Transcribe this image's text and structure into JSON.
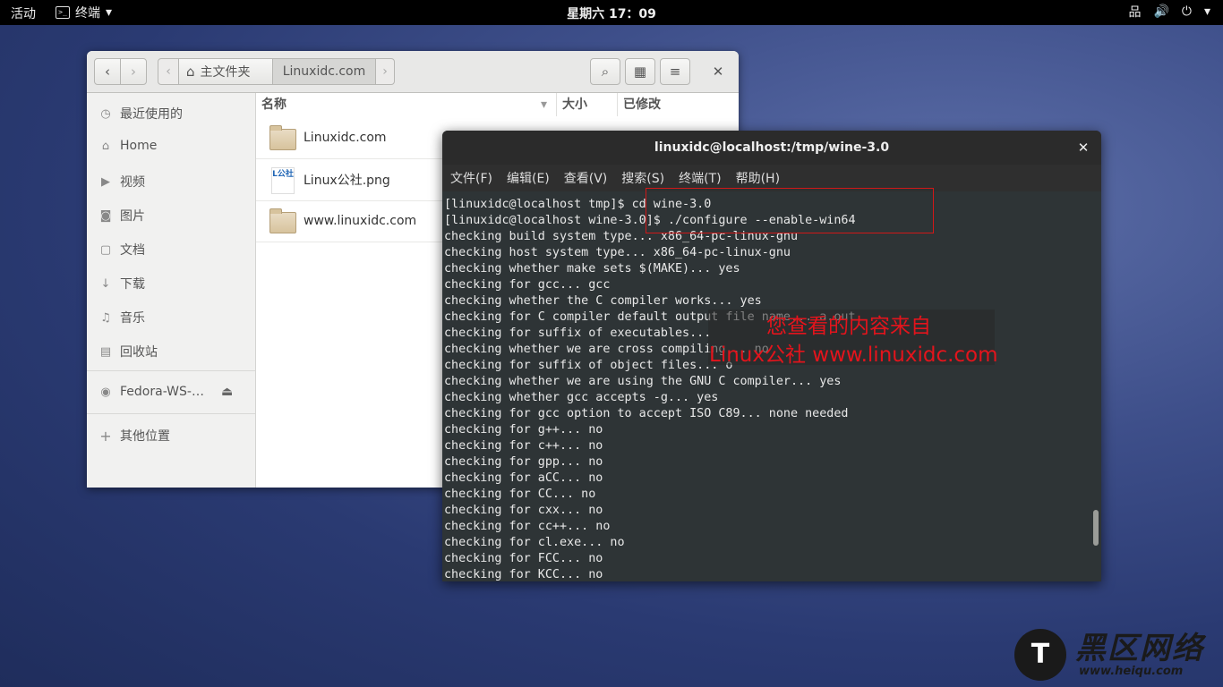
{
  "topbar": {
    "activities": "活动",
    "app_name": "终端",
    "app_arrow": "▾",
    "clock": "星期六 17：09",
    "tray": {
      "network_glyph": "品",
      "volume_glyph": "🔊",
      "power_glyph": "⏻",
      "arrow": "▾"
    }
  },
  "files": {
    "nav": {
      "back": "‹",
      "forward": "›",
      "crumb_left": "‹",
      "crumb_right": "›"
    },
    "breadcrumb": {
      "home_label": "主文件夹",
      "current": "Linuxidc.com"
    },
    "header_buttons": {
      "search": "⌕",
      "grid": "▦",
      "menu": "≡",
      "close": "✕"
    },
    "sidebar": {
      "items": [
        {
          "icon": "◷",
          "label": "最近使用的"
        },
        {
          "icon": "⌂",
          "label": "Home"
        },
        {
          "icon": "▶",
          "label": "视频"
        },
        {
          "icon": "◙",
          "label": "图片"
        },
        {
          "icon": "▢",
          "label": "文档"
        },
        {
          "icon": "↓",
          "label": "下载"
        },
        {
          "icon": "♫",
          "label": "音乐"
        },
        {
          "icon": "▤",
          "label": "回收站"
        }
      ],
      "device": {
        "icon": "◉",
        "label": "Fedora-WS-…",
        "eject": "⏏"
      },
      "other": {
        "icon": "+",
        "label": "其他位置"
      }
    },
    "columns": {
      "name": "名称",
      "size": "大小",
      "modified": "已修改",
      "sort_arrow": "▾"
    },
    "rows": [
      {
        "name": "Linuxidc.com",
        "type": "folder"
      },
      {
        "name": "Linux公社.png",
        "type": "png",
        "thumb_text": "L公社"
      },
      {
        "name": "www.linuxidc.com",
        "type": "folder"
      }
    ]
  },
  "terminal": {
    "title": "linuxidc@localhost:/tmp/wine-3.0",
    "close": "✕",
    "menu": [
      "文件(F)",
      "编辑(E)",
      "查看(V)",
      "搜索(S)",
      "终端(T)",
      "帮助(H)"
    ],
    "lines": [
      "[linuxidc@localhost tmp]$ cd wine-3.0",
      "[linuxidc@localhost wine-3.0]$ ./configure --enable-win64",
      "checking build system type... x86_64-pc-linux-gnu",
      "checking host system type... x86_64-pc-linux-gnu",
      "checking whether make sets $(MAKE)... yes",
      "checking for gcc... gcc",
      "checking whether the C compiler works... yes",
      "checking for C compiler default output file name... a.out",
      "checking for suffix of executables...",
      "checking whether we are cross compiling... no",
      "checking for suffix of object files... o",
      "checking whether we are using the GNU C compiler... yes",
      "checking whether gcc accepts -g... yes",
      "checking for gcc option to accept ISO C89... none needed",
      "checking for g++... no",
      "checking for c++... no",
      "checking for gpp... no",
      "checking for aCC... no",
      "checking for CC... no",
      "checking for cxx... no",
      "checking for cc++... no",
      "checking for cl.exe... no",
      "checking for FCC... no",
      "checking for KCC... no"
    ],
    "watermark": {
      "line1": "您查看的内容来自",
      "line2": "Linux公社 www.linuxidc.com"
    }
  },
  "corner_logo": {
    "mark": "T",
    "name": "黑区网络",
    "url": "www.heiqu.com"
  }
}
